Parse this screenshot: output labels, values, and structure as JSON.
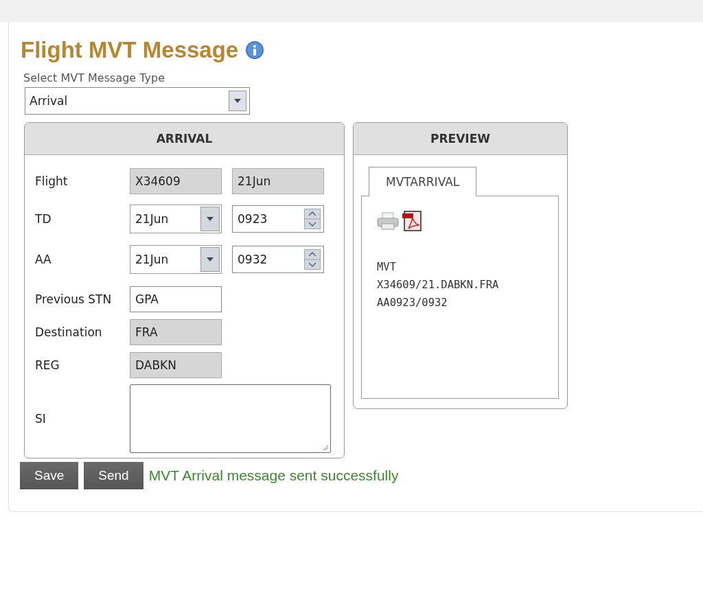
{
  "title": "Flight MVT Message",
  "type_select": {
    "label": "Select MVT Message Type",
    "value": "Arrival"
  },
  "arrival": {
    "heading": "ARRIVAL",
    "rows": [
      {
        "kind": "readonly-pair",
        "label": "Flight",
        "values": [
          "X34609",
          "21Jun"
        ]
      },
      {
        "kind": "date-time",
        "label": "TD",
        "date": "21Jun",
        "time": "0923"
      },
      {
        "kind": "date-time",
        "label": "AA",
        "date": "21Jun",
        "time": "0932"
      },
      {
        "kind": "text",
        "label": "Previous STN",
        "value": "GPA"
      },
      {
        "kind": "readonly",
        "label": "Destination",
        "value": "FRA"
      },
      {
        "kind": "readonly",
        "label": "REG",
        "value": "DABKN"
      },
      {
        "kind": "textarea",
        "label": "SI"
      }
    ]
  },
  "preview": {
    "heading": "PREVIEW",
    "tabs": [
      {
        "label": "MVTARRIVAL",
        "selected": true
      }
    ],
    "message_lines": [
      "MVT",
      "X34609/21.DABKN.FRA",
      "AA0923/0932"
    ]
  },
  "buttons": [
    "Save",
    "Send"
  ],
  "status": "MVT Arrival message sent successfully"
}
